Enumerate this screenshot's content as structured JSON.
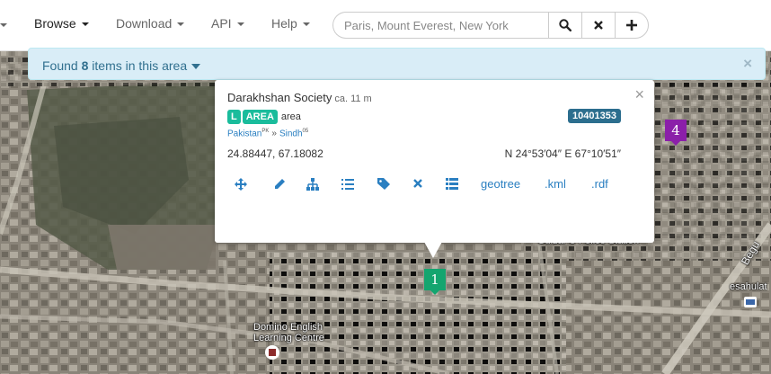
{
  "nav": {
    "items": [
      {
        "label": "Browse",
        "active": true
      },
      {
        "label": "Download",
        "active": false
      },
      {
        "label": "API",
        "active": false
      },
      {
        "label": "Help",
        "active": false
      }
    ],
    "search_placeholder": "Paris, Mount Everest, New York",
    "search_icon": "search-icon",
    "clear_icon": "close-icon",
    "add_icon": "plus-icon"
  },
  "alert": {
    "prefix": "Found",
    "count": "8",
    "suffix": "items in this area",
    "close": "×"
  },
  "popup": {
    "close": "×",
    "title": "Darakhshan Society",
    "size": "ca. 11 m",
    "badge_l": "L",
    "badge_area": "AREA",
    "type_text": "area",
    "id": "10401353",
    "country": "Pakistan",
    "country_code": "PK",
    "separator": "»",
    "region": "Sindh",
    "region_code": "05",
    "coords_decimal": "24.88447, 67.18082",
    "coords_dms": "N 24°53′04″ E 67°10′51″",
    "actions": {
      "move_icon": "move-arrows-icon",
      "edit_icon": "pencil-icon",
      "hierarchy_icon": "sitemap-icon",
      "list_icon": "ordered-list-icon",
      "tags_icon": "tags-icon",
      "delete_icon": "close-icon",
      "table_icon": "table-list-icon",
      "geotree": "geotree",
      "kml": ".kml",
      "rdf": ".rdf"
    }
  },
  "markers": [
    {
      "label": "1",
      "color": "#14a56f"
    },
    {
      "label": "4",
      "color": "#8b1fa9"
    }
  ],
  "map_labels": {
    "domino": "Domino English Learning Centre",
    "station": "Gulzar-e-Police Station",
    "esahulat": "esahulat",
    "begum": "Begu"
  },
  "colors": {
    "alert_bg": "#d9edf7",
    "accent": "#2a7fc1",
    "badge": "#1abc9c",
    "id_badge": "#2c6e8e"
  }
}
